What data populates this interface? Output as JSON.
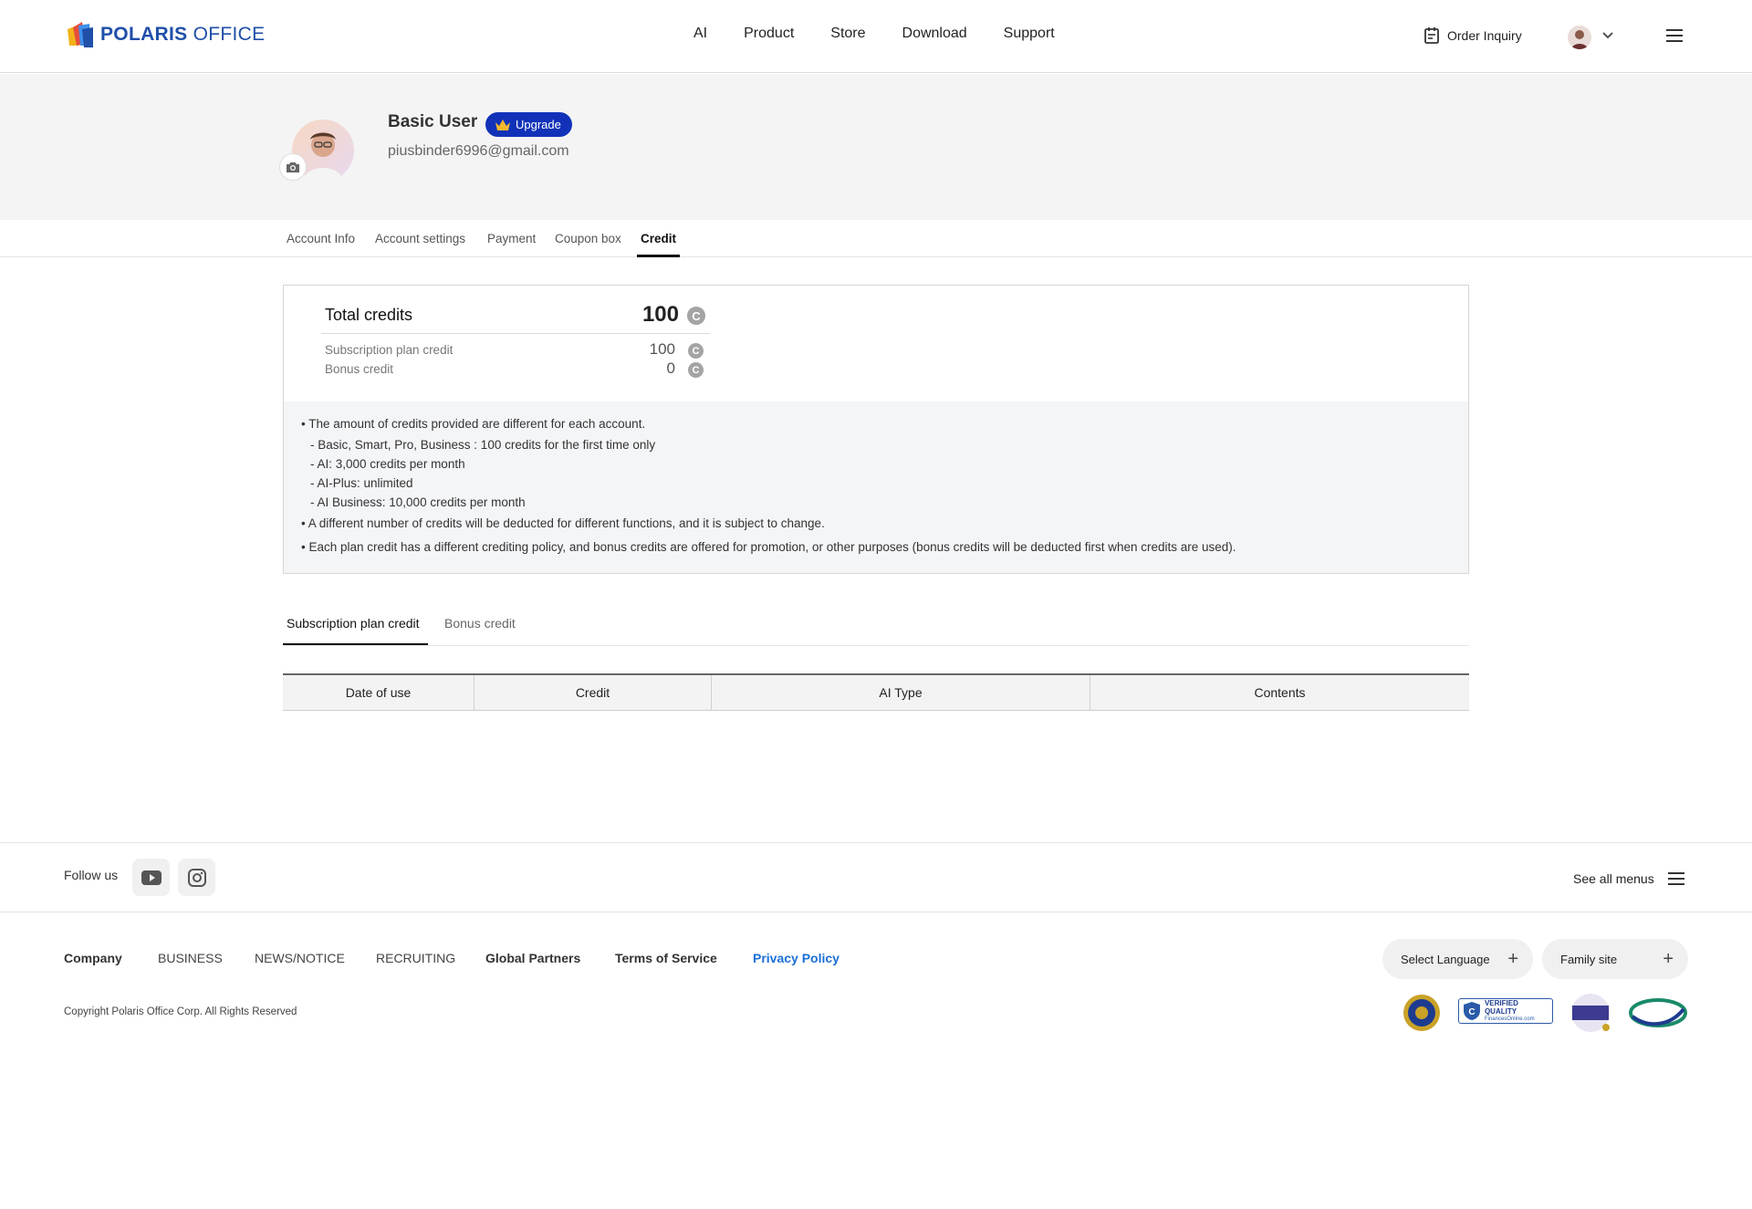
{
  "brand": {
    "logo_text_bold": "POLARIS",
    "logo_text_rest": " OFFICE"
  },
  "nav": {
    "items": [
      "AI",
      "Product",
      "Store",
      "Download",
      "Support"
    ]
  },
  "header": {
    "order_inquiry": "Order Inquiry"
  },
  "profile": {
    "name": "Basic User",
    "upgrade_label": "Upgrade",
    "email": "piusbinder6996@gmail.com"
  },
  "account_tabs": [
    "Account Info",
    "Account settings",
    "Payment",
    "Coupon box",
    "Credit"
  ],
  "credits": {
    "total_label": "Total credits",
    "total_value": "100",
    "subscription_label": "Subscription plan credit",
    "subscription_value": "100",
    "bonus_label": "Bonus credit",
    "bonus_value": "0",
    "coin_glyph": "C"
  },
  "notes": [
    "• The amount of credits provided are different for each account.",
    "-  Basic, Smart, Pro, Business : 100 credits for the first time only",
    "-  AI: 3,000 credits per month",
    "-  AI-Plus: unlimited",
    "-  AI Business: 10,000 credits per month",
    "• A different number of credits will be deducted for different functions, and it is subject to change.",
    "• Each plan credit has a different crediting policy, and bonus credits are offered for promotion, or other purposes (bonus credits will be deducted first when credits are used)."
  ],
  "credit_tabs": [
    "Subscription plan credit",
    "Bonus credit"
  ],
  "table": {
    "headers": [
      "Date of use",
      "Credit",
      "AI Type",
      "Contents"
    ]
  },
  "footer": {
    "follow_us": "Follow us",
    "see_all_menus": "See all menus",
    "links": [
      "Company",
      "BUSINESS",
      "NEWS/NOTICE",
      "RECRUITING",
      "Global Partners",
      "Terms of Service",
      "Privacy Policy"
    ],
    "select_language": "Select Language",
    "family_site": "Family site",
    "copyright": "Copyright Polaris Office Corp. All Rights Reserved",
    "badge_verified_title": "VERIFIED QUALITY",
    "badge_verified_sub": "FinancesOnline.com"
  },
  "colors": {
    "upgrade_bg": "#1132b8",
    "privacy_link": "#1a6fd6",
    "brand": "#1f4fa8"
  },
  "icons": [
    "logo-icon",
    "calendar-icon",
    "chevron-down-icon",
    "hamburger-icon",
    "camera-icon",
    "crown-icon",
    "credit-coin-icon",
    "youtube-icon",
    "instagram-icon",
    "plus-icon"
  ]
}
